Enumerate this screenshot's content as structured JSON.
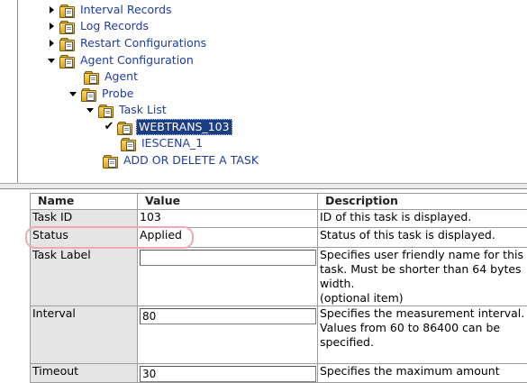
{
  "tree": {
    "interval_records": "Interval Records",
    "log_records": "Log Records",
    "restart_configurations": "Restart Configurations",
    "agent_configuration": "Agent Configuration",
    "agent": "Agent",
    "probe": "Probe",
    "task_list": "Task List",
    "task_webtrans": "WEBTRANS_103",
    "task_iescena": "IESCENA_1",
    "add_delete": "ADD OR DELETE A TASK"
  },
  "table": {
    "headers": {
      "name": "Name",
      "value": "Value",
      "description": "Description"
    },
    "rows": {
      "task_id": {
        "name": "Task ID",
        "value": "103",
        "description": "ID of this task is displayed."
      },
      "status": {
        "name": "Status",
        "value": "Applied",
        "description": "Status of this task is displayed."
      },
      "task_label": {
        "name": "Task Label",
        "value": "",
        "description": "Specifies user friendly name for this task. Must be shorter than 64 bytes width.",
        "description_note": "(optional item)"
      },
      "interval": {
        "name": "Interval",
        "value": "80",
        "description": "Specifies the measurement interval.",
        "description_note": "Values from 60 to 86400 can be specified."
      },
      "timeout": {
        "name": "Timeout",
        "value": "30",
        "description": "Specifies the maximum amount"
      }
    }
  },
  "colors": {
    "link": "#1f3d9c",
    "selected_bg": "#1c3d82",
    "highlight": "#f3a7b0",
    "name_cell_bg": "#e5e5e5"
  }
}
